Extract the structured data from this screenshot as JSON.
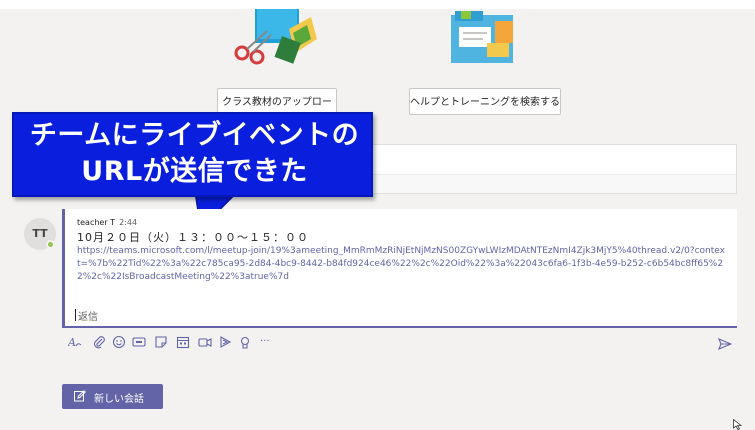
{
  "actions": {
    "upload_label": "クラス教材のアップロード",
    "help_label": "ヘルプとトレーニングを検索する"
  },
  "callout": {
    "line1": "チームにライブイベントの",
    "line2": "URLが送信できた"
  },
  "message": {
    "avatar_initials": "TT",
    "author": "teacher T",
    "time": "2:44",
    "date_line": "10月２０日（火）１３：００～１５：００",
    "link": "https://teams.microsoft.com/l/meetup-join/19%3ameeting_MmRmMzRiNjEtNjMzNS00ZGYwLWIzMDAtNTEzNmI4Zjk3MjY5%40thread.v2/0?context=%7b%22Tid%22%3a%22c785ca95-2d84-4bc9-8442-b84fd924ce46%22%2c%22Oid%22%3a%22043c6fa6-1f3b-4e59-b252-c6b54bc8ff65%22%2c%22IsBroadcastMeeting%22%3atrue%7d"
  },
  "reply": {
    "label": "返信"
  },
  "toolbar": {
    "icons": [
      "format-icon",
      "attach-icon",
      "emoji-icon",
      "gif-icon",
      "sticker-icon",
      "schedule-meeting-icon",
      "meet-now-icon",
      "stream-icon",
      "praise-icon",
      "more-options-icon"
    ],
    "more_label": "···"
  },
  "new_conversation": {
    "label": "新しい会話"
  },
  "colors": {
    "accent": "#6264a7",
    "callout_bg": "#0a1ede",
    "background": "#f3f2f1",
    "presence_available": "#92c353"
  }
}
